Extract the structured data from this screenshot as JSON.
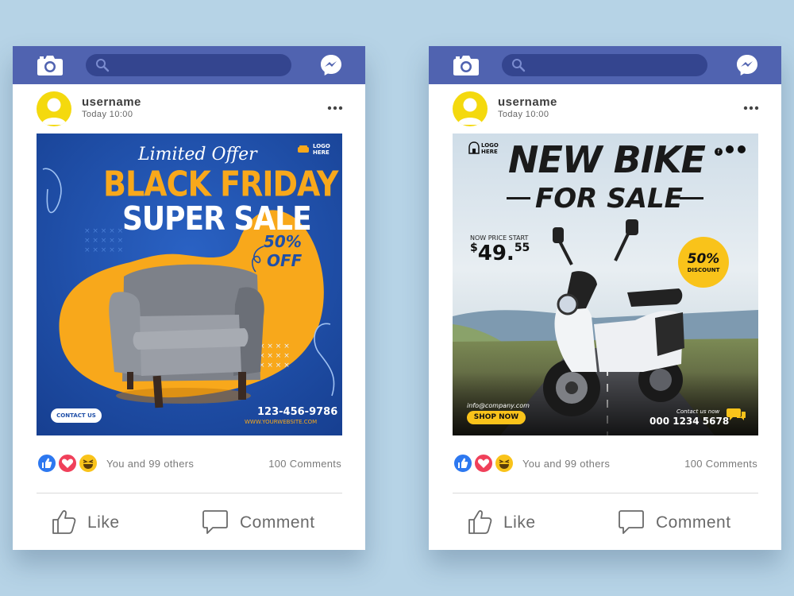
{
  "posts": [
    {
      "username": "username",
      "time": "Today 10:00",
      "reactions_text": "You and 99 others",
      "comments_text": "100 Comments",
      "like_label": "Like",
      "comment_label": "Comment",
      "ad": {
        "script_title": "Limited Offer",
        "headline": "BLACK FRIDAY",
        "subheadline": "SUPER SALE",
        "discount_value": "50%",
        "discount_word": "OFF",
        "logo_line1": "LOGO",
        "logo_line2": "HERE",
        "cta": "CONTACT US",
        "phone": "123-456-9786",
        "website": "WWW.YOURWEBSITE.COM"
      }
    },
    {
      "username": "username",
      "time": "Today 10:00",
      "reactions_text": "You and 99 others",
      "comments_text": "100 Comments",
      "like_label": "Like",
      "comment_label": "Comment",
      "ad": {
        "logo_line1": "LOGO",
        "logo_line2": "HERE",
        "headline": "NEW BIKE",
        "subheadline": "FOR SALE",
        "price_label": "NOW PRICE START",
        "price_currency": "$",
        "price_main": "49.",
        "price_cents": "55",
        "discount_value": "50%",
        "discount_word": "DISCOUNT",
        "email": "info@company.com",
        "cta": "SHOP NOW",
        "contact_label": "Contact us now",
        "phone": "000 1234 5678"
      }
    }
  ],
  "colors": {
    "background": "#b6d3e6",
    "topbar": "#5063b0",
    "search": "#34458f",
    "avatar": "#f4d90e",
    "ad_blue": "#1f4fa8",
    "ad_orange": "#f8a81b",
    "ad_yellow": "#f9c31a"
  }
}
